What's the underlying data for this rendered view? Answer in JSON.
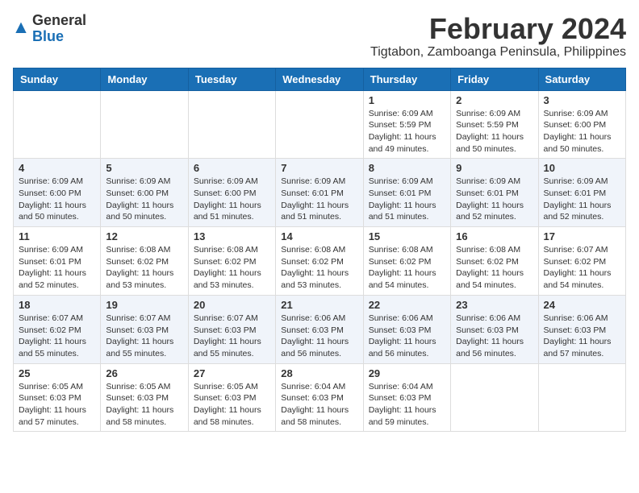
{
  "logo": {
    "general": "General",
    "blue": "Blue"
  },
  "title": "February 2024",
  "subtitle": "Tigtabon, Zamboanga Peninsula, Philippines",
  "days_of_week": [
    "Sunday",
    "Monday",
    "Tuesday",
    "Wednesday",
    "Thursday",
    "Friday",
    "Saturday"
  ],
  "weeks": [
    [
      {
        "day": "",
        "info": ""
      },
      {
        "day": "",
        "info": ""
      },
      {
        "day": "",
        "info": ""
      },
      {
        "day": "",
        "info": ""
      },
      {
        "day": "1",
        "info": "Sunrise: 6:09 AM\nSunset: 5:59 PM\nDaylight: 11 hours and 49 minutes."
      },
      {
        "day": "2",
        "info": "Sunrise: 6:09 AM\nSunset: 5:59 PM\nDaylight: 11 hours and 50 minutes."
      },
      {
        "day": "3",
        "info": "Sunrise: 6:09 AM\nSunset: 6:00 PM\nDaylight: 11 hours and 50 minutes."
      }
    ],
    [
      {
        "day": "4",
        "info": "Sunrise: 6:09 AM\nSunset: 6:00 PM\nDaylight: 11 hours and 50 minutes."
      },
      {
        "day": "5",
        "info": "Sunrise: 6:09 AM\nSunset: 6:00 PM\nDaylight: 11 hours and 50 minutes."
      },
      {
        "day": "6",
        "info": "Sunrise: 6:09 AM\nSunset: 6:00 PM\nDaylight: 11 hours and 51 minutes."
      },
      {
        "day": "7",
        "info": "Sunrise: 6:09 AM\nSunset: 6:01 PM\nDaylight: 11 hours and 51 minutes."
      },
      {
        "day": "8",
        "info": "Sunrise: 6:09 AM\nSunset: 6:01 PM\nDaylight: 11 hours and 51 minutes."
      },
      {
        "day": "9",
        "info": "Sunrise: 6:09 AM\nSunset: 6:01 PM\nDaylight: 11 hours and 52 minutes."
      },
      {
        "day": "10",
        "info": "Sunrise: 6:09 AM\nSunset: 6:01 PM\nDaylight: 11 hours and 52 minutes."
      }
    ],
    [
      {
        "day": "11",
        "info": "Sunrise: 6:09 AM\nSunset: 6:01 PM\nDaylight: 11 hours and 52 minutes."
      },
      {
        "day": "12",
        "info": "Sunrise: 6:08 AM\nSunset: 6:02 PM\nDaylight: 11 hours and 53 minutes."
      },
      {
        "day": "13",
        "info": "Sunrise: 6:08 AM\nSunset: 6:02 PM\nDaylight: 11 hours and 53 minutes."
      },
      {
        "day": "14",
        "info": "Sunrise: 6:08 AM\nSunset: 6:02 PM\nDaylight: 11 hours and 53 minutes."
      },
      {
        "day": "15",
        "info": "Sunrise: 6:08 AM\nSunset: 6:02 PM\nDaylight: 11 hours and 54 minutes."
      },
      {
        "day": "16",
        "info": "Sunrise: 6:08 AM\nSunset: 6:02 PM\nDaylight: 11 hours and 54 minutes."
      },
      {
        "day": "17",
        "info": "Sunrise: 6:07 AM\nSunset: 6:02 PM\nDaylight: 11 hours and 54 minutes."
      }
    ],
    [
      {
        "day": "18",
        "info": "Sunrise: 6:07 AM\nSunset: 6:02 PM\nDaylight: 11 hours and 55 minutes."
      },
      {
        "day": "19",
        "info": "Sunrise: 6:07 AM\nSunset: 6:03 PM\nDaylight: 11 hours and 55 minutes."
      },
      {
        "day": "20",
        "info": "Sunrise: 6:07 AM\nSunset: 6:03 PM\nDaylight: 11 hours and 55 minutes."
      },
      {
        "day": "21",
        "info": "Sunrise: 6:06 AM\nSunset: 6:03 PM\nDaylight: 11 hours and 56 minutes."
      },
      {
        "day": "22",
        "info": "Sunrise: 6:06 AM\nSunset: 6:03 PM\nDaylight: 11 hours and 56 minutes."
      },
      {
        "day": "23",
        "info": "Sunrise: 6:06 AM\nSunset: 6:03 PM\nDaylight: 11 hours and 56 minutes."
      },
      {
        "day": "24",
        "info": "Sunrise: 6:06 AM\nSunset: 6:03 PM\nDaylight: 11 hours and 57 minutes."
      }
    ],
    [
      {
        "day": "25",
        "info": "Sunrise: 6:05 AM\nSunset: 6:03 PM\nDaylight: 11 hours and 57 minutes."
      },
      {
        "day": "26",
        "info": "Sunrise: 6:05 AM\nSunset: 6:03 PM\nDaylight: 11 hours and 58 minutes."
      },
      {
        "day": "27",
        "info": "Sunrise: 6:05 AM\nSunset: 6:03 PM\nDaylight: 11 hours and 58 minutes."
      },
      {
        "day": "28",
        "info": "Sunrise: 6:04 AM\nSunset: 6:03 PM\nDaylight: 11 hours and 58 minutes."
      },
      {
        "day": "29",
        "info": "Sunrise: 6:04 AM\nSunset: 6:03 PM\nDaylight: 11 hours and 59 minutes."
      },
      {
        "day": "",
        "info": ""
      },
      {
        "day": "",
        "info": ""
      }
    ]
  ]
}
